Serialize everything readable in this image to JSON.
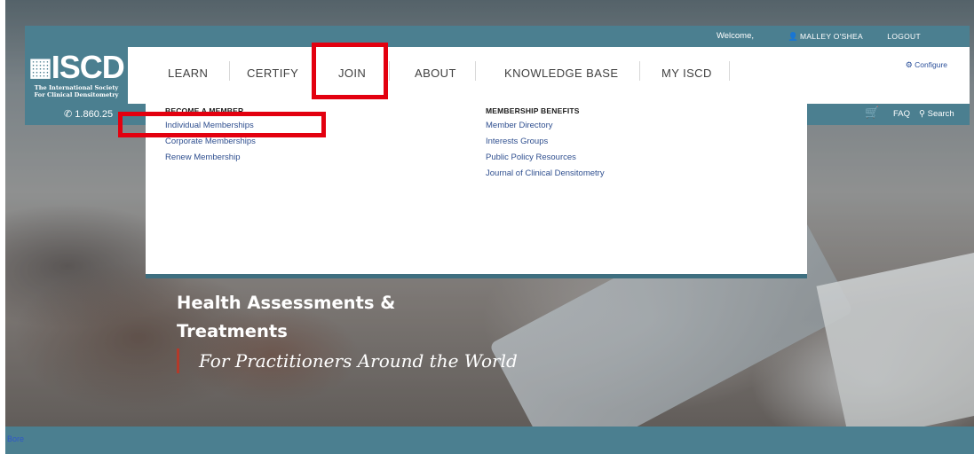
{
  "header": {
    "welcome": "Welcome,",
    "user": "MALLEY O'SHEA",
    "logout": "LOGOUT"
  },
  "logo": {
    "mark": "ISCD",
    "subtitle_line1": "The International Society",
    "subtitle_line2": "For Clinical Densitometry"
  },
  "nav": {
    "items": [
      "LEARN",
      "CERTIFY",
      "JOIN",
      "ABOUT",
      "KNOWLEDGE BASE",
      "MY ISCD"
    ],
    "active": "JOIN",
    "configure": "Configure"
  },
  "contact": {
    "phone": "1.860.25"
  },
  "utility": {
    "faq": "FAQ",
    "search": "Search"
  },
  "dropdown": {
    "col1_heading": "BECOME A MEMBER",
    "col1_links": [
      "Individual Memberships",
      "Corporate Memberships",
      "Renew Membership"
    ],
    "col2_heading": "MEMBERSHIP BENEFITS",
    "col2_links": [
      "Member Directory",
      "Interests Groups",
      "Public Policy Resources",
      "Journal of Clinical Densitometry"
    ]
  },
  "hero": {
    "title_line1": "Health Assessments &",
    "title_line2": "Treatments",
    "tagline": "For Practitioners Around the World"
  },
  "footer": {
    "link": "Bore"
  },
  "colors": {
    "brand": "#4b7f90",
    "accent": "#b33a2a",
    "highlight": "#e3000f",
    "link": "#2f4f8f"
  },
  "icons": {
    "user": "user-icon",
    "configure": "gear-icon",
    "phone": "phone-icon",
    "cart": "cart-icon",
    "search": "search-icon",
    "logo": "globe-icon"
  }
}
